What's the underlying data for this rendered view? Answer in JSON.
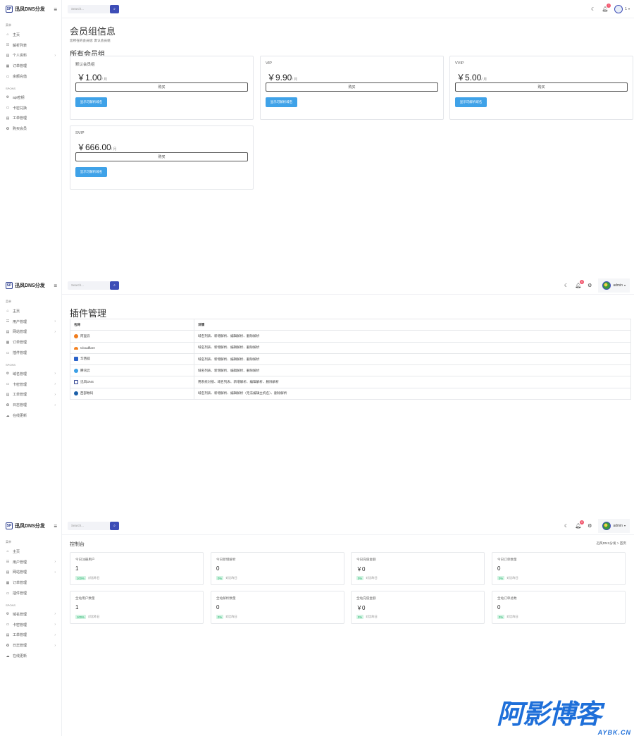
{
  "brand": "迅风DNS分发",
  "brand_logo": "SP",
  "search_placeholder": "Search...",
  "panel1": {
    "sec1": "菜单",
    "nav1": [
      "主页",
      "解析列表",
      "个人资料",
      "订单管理",
      "余额充值"
    ],
    "sec2": "SPONS",
    "nav2": [
      "api密钥",
      "卡密兑换",
      "工单管理",
      "购买会员"
    ],
    "notif_count": "1",
    "user_label": "1",
    "title": "会员组信息",
    "subtitle": "您所在的会员组: 默认会员组",
    "section": "所有会员组",
    "buy_label": "购买",
    "show_label": "显示可解析域名",
    "per_month": "/ 月",
    "groups": [
      {
        "name": "默认会员组",
        "price": "￥1.00"
      },
      {
        "name": "VIP",
        "price": "￥9.90"
      },
      {
        "name": "VVIP",
        "price": "￥5.00"
      },
      {
        "name": "SVIP",
        "price": "￥666.00"
      }
    ]
  },
  "panel2": {
    "sec1": "菜单",
    "nav1": [
      "主页",
      "用户管理",
      "网站管理",
      "订单管理",
      "插件管理"
    ],
    "sec2": "SPONS",
    "nav2": [
      "域名管理",
      "卡密管理",
      "工单管理",
      "日志管理",
      "在线更新"
    ],
    "notif_count": "0",
    "user_label": "admin",
    "title": "插件管理",
    "col_name": "名称",
    "col_detail": "详情",
    "plugins": [
      {
        "name": "阿里云",
        "detail": "域名列表、新增解析、编辑解析、删除解析",
        "color": "#f07c1c"
      },
      {
        "name": "Cloudflare",
        "detail": "域名列表、新增解析、编辑解析、删除解析",
        "color": "#f48120"
      },
      {
        "name": "华西狐",
        "detail": "域名列表、新增解析、编辑解析、删除解析",
        "color": "#2a62c9"
      },
      {
        "name": "腾讯云",
        "detail": "域名列表、新增解析、编辑解析、删除解析",
        "color": "#3ba0e6"
      },
      {
        "name": "迅风DNS",
        "detail": "用系统对接、域名列表、新增解析、编辑解析、删除解析",
        "color": "#2c3e8f"
      },
      {
        "name": "西部数码",
        "detail": "域名列表、新增解析、编辑解析（无法编辑主机名）、删除解析",
        "color": "#1b5fa8"
      }
    ]
  },
  "panel3": {
    "sec1": "菜单",
    "nav1": [
      "主页",
      "用户管理",
      "网站管理",
      "订单管理",
      "插件管理"
    ],
    "sec2": "SPONS",
    "nav2": [
      "域名管理",
      "卡密管理",
      "工单管理",
      "日志管理",
      "在线更新"
    ],
    "notif_count": "0",
    "user_label": "admin",
    "title": "控制台",
    "breadcrumb": "迅风DNS分发  >  首页",
    "compare": "对比昨日",
    "stats": [
      {
        "label": "今日注册用户",
        "value": "1",
        "pct": "100%"
      },
      {
        "label": "今日新增解析",
        "value": "0",
        "pct": "0%"
      },
      {
        "label": "今日充值金额",
        "value": "￥0",
        "pct": "0%"
      },
      {
        "label": "今日订单数量",
        "value": "0",
        "pct": "0%"
      },
      {
        "label": "全站用户数量",
        "value": "1",
        "pct": "100%"
      },
      {
        "label": "全站解析数量",
        "value": "0",
        "pct": "0%"
      },
      {
        "label": "全站充值金额",
        "value": "￥0",
        "pct": "0%"
      },
      {
        "label": "全站订单总数",
        "value": "0",
        "pct": "0%"
      }
    ]
  },
  "watermark": {
    "big": "阿影博客",
    "small": "AYBK.CN"
  },
  "colors": {
    "primary": "#3d4db7",
    "button_blue": "#3fa2e8",
    "success": "#1ab368",
    "watermark": "#1e6fd9"
  }
}
